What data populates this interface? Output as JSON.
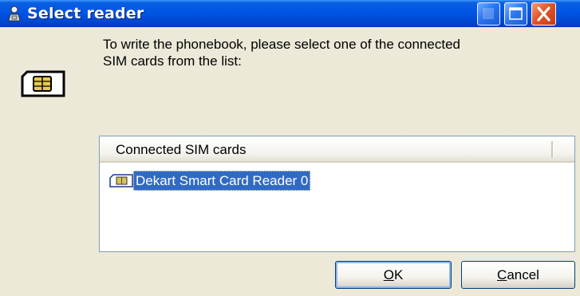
{
  "window": {
    "title": "Select reader",
    "title_icon": "user-lock-icon"
  },
  "titlebar_buttons": [
    "help-button",
    "maximize-button",
    "close-button"
  ],
  "message": {
    "line1": "To write the phonebook, please select one of the connected",
    "line2": "SIM cards from the list:"
  },
  "list": {
    "column_header": "Connected SIM cards",
    "items": [
      {
        "label": "Dekart Smart Card Reader 0",
        "icon": "sim-card-icon",
        "selected": true
      }
    ]
  },
  "buttons": {
    "ok": {
      "accel": "O",
      "rest": "K"
    },
    "cancel": {
      "accel": "C",
      "rest": "ancel"
    }
  },
  "colors": {
    "titlebar": "#0055e5",
    "dialog_bg": "#ece9d8",
    "selection": "#316ac5",
    "close_button": "#e2542a"
  }
}
